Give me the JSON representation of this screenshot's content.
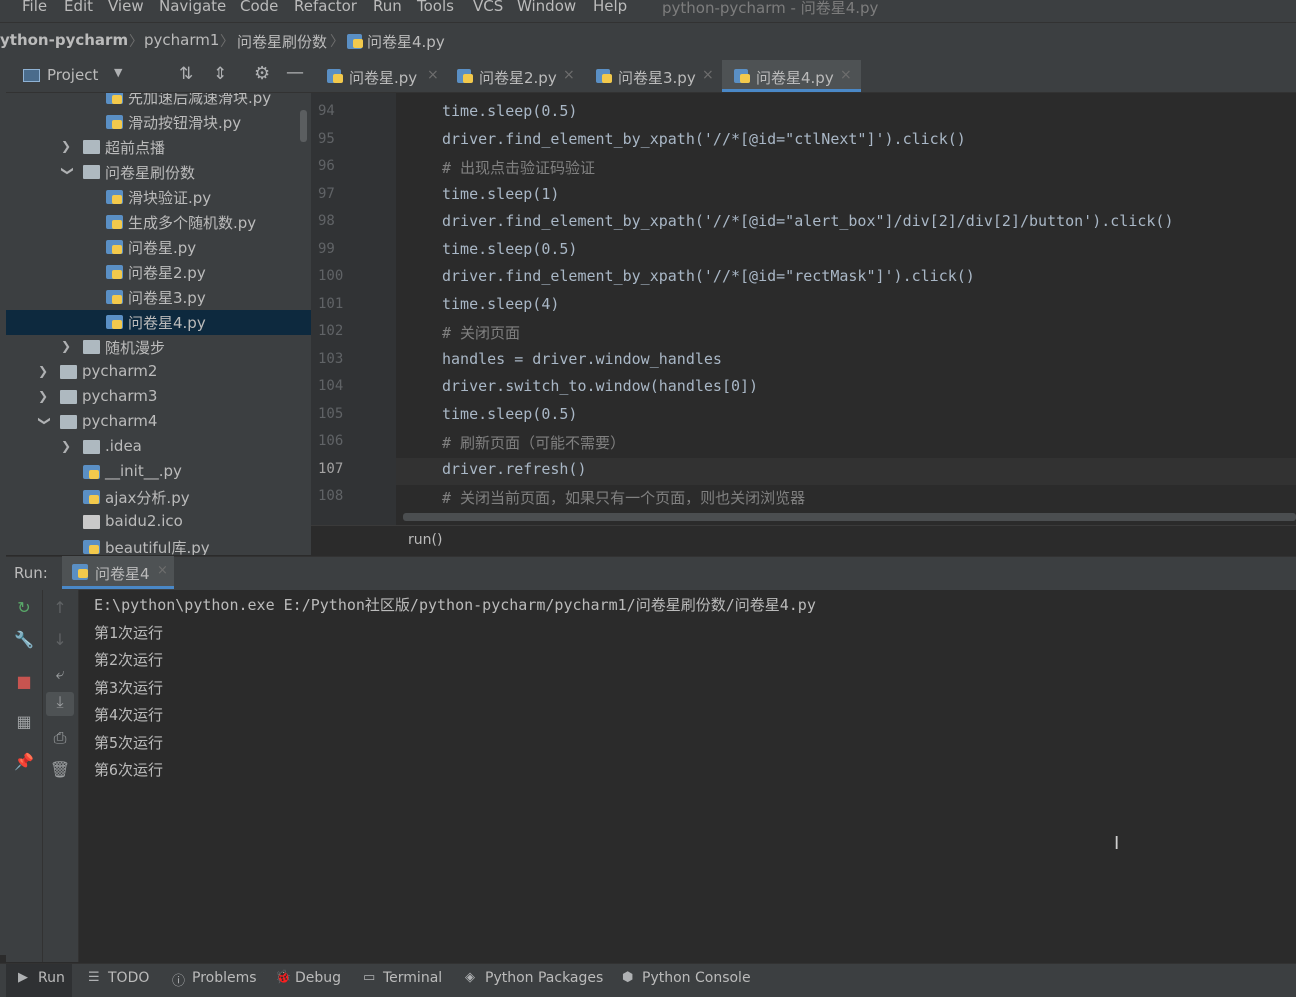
{
  "menu": [
    "File",
    "Edit",
    "View",
    "Navigate",
    "Code",
    "Refactor",
    "Run",
    "Tools",
    "VCS",
    "Window",
    "Help"
  ],
  "window_title": "python-pycharm - 问卷星4.py",
  "breadcrumb": [
    "ython-pycharm",
    "pycharm1",
    "问卷星刷份数",
    "问卷星4.py"
  ],
  "project_panel": {
    "title": "Project"
  },
  "tree": [
    {
      "label": "先加速后减速滑块.py",
      "type": "py",
      "indent": 2
    },
    {
      "label": "滑动按钮滑块.py",
      "type": "py",
      "indent": 2
    },
    {
      "label": "超前点播",
      "type": "folder",
      "indent": 1,
      "arrow": "›"
    },
    {
      "label": "问卷星刷份数",
      "type": "folder",
      "indent": 1,
      "arrow": "⌄"
    },
    {
      "label": "滑块验证.py",
      "type": "py",
      "indent": 2
    },
    {
      "label": "生成多个随机数.py",
      "type": "py",
      "indent": 2
    },
    {
      "label": "问卷星.py",
      "type": "py",
      "indent": 2
    },
    {
      "label": "问卷星2.py",
      "type": "py",
      "indent": 2
    },
    {
      "label": "问卷星3.py",
      "type": "py",
      "indent": 2
    },
    {
      "label": "问卷星4.py",
      "type": "py",
      "indent": 2,
      "selected": true
    },
    {
      "label": "随机漫步",
      "type": "folder",
      "indent": 1,
      "arrow": "›"
    },
    {
      "label": "pycharm2",
      "type": "folder",
      "indent": 0,
      "arrow": "›"
    },
    {
      "label": "pycharm3",
      "type": "folder",
      "indent": 0,
      "arrow": "›"
    },
    {
      "label": "pycharm4",
      "type": "folder",
      "indent": 0,
      "arrow": "⌄"
    },
    {
      "label": ".idea",
      "type": "folder",
      "indent": 1,
      "arrow": "›"
    },
    {
      "label": "__init__.py",
      "type": "py",
      "indent": 1
    },
    {
      "label": "ajax分析.py",
      "type": "py",
      "indent": 1
    },
    {
      "label": "baidu2.ico",
      "type": "ico",
      "indent": 1
    },
    {
      "label": "beautiful库.py",
      "type": "py",
      "indent": 1
    }
  ],
  "tabs": [
    {
      "label": "问卷星.py",
      "active": false
    },
    {
      "label": "问卷星2.py",
      "active": false
    },
    {
      "label": "问卷星3.py",
      "active": false
    },
    {
      "label": "问卷星4.py",
      "active": true
    }
  ],
  "code": [
    {
      "ln": "94",
      "text": "time.sleep(0.5)",
      "kind": "code"
    },
    {
      "ln": "95",
      "text": "driver.find_element_by_xpath('//*[@id=\"ctlNext\"]').click()",
      "kind": "code"
    },
    {
      "ln": "96",
      "text": "# 出现点击验证码验证",
      "kind": "cmt"
    },
    {
      "ln": "97",
      "text": "time.sleep(1)",
      "kind": "code"
    },
    {
      "ln": "98",
      "text": "driver.find_element_by_xpath('//*[@id=\"alert_box\"]/div[2]/div[2]/button').click()",
      "kind": "code"
    },
    {
      "ln": "99",
      "text": "time.sleep(0.5)",
      "kind": "code"
    },
    {
      "ln": "100",
      "text": "driver.find_element_by_xpath('//*[@id=\"rectMask\"]').click()",
      "kind": "code"
    },
    {
      "ln": "101",
      "text": "time.sleep(4)",
      "kind": "code"
    },
    {
      "ln": "102",
      "text": "# 关闭页面",
      "kind": "cmt"
    },
    {
      "ln": "103",
      "text": "handles = driver.window_handles",
      "kind": "code"
    },
    {
      "ln": "104",
      "text": "driver.switch_to.window(handles[0])",
      "kind": "code"
    },
    {
      "ln": "105",
      "text": "time.sleep(0.5)",
      "kind": "code"
    },
    {
      "ln": "106",
      "text": "# 刷新页面（可能不需要）",
      "kind": "cmt"
    },
    {
      "ln": "107",
      "text": "driver.refresh()",
      "kind": "code",
      "current": true
    },
    {
      "ln": "108",
      "text": "# 关闭当前页面，如果只有一个页面，则也关闭浏览器",
      "kind": "cmt"
    }
  ],
  "editor_breadcrumb": "run()",
  "run_panel": {
    "label": "Run:",
    "tab": "问卷星4",
    "output": [
      "E:\\python\\python.exe E:/Python社区版/python-pycharm/pycharm1/问卷星刷份数/问卷星4.py",
      "第1次运行",
      "第2次运行",
      "第3次运行",
      "第4次运行",
      "第5次运行",
      "第6次运行"
    ]
  },
  "statusbar": [
    {
      "label": "Run",
      "icon": "run-icon"
    },
    {
      "label": "TODO",
      "icon": "todo-icon"
    },
    {
      "label": "Problems",
      "icon": "problems-icon"
    },
    {
      "label": "Debug",
      "icon": "debug-icon"
    },
    {
      "label": "Terminal",
      "icon": "terminal-icon"
    },
    {
      "label": "Python Packages",
      "icon": "packages-icon"
    },
    {
      "label": "Python Console",
      "icon": "python-console-icon"
    }
  ],
  "colors": {
    "background": "#2b2b2b",
    "panel": "#3c3f41",
    "selection": "#0d293e",
    "accent": "#4a88c7",
    "comment": "#808080"
  }
}
